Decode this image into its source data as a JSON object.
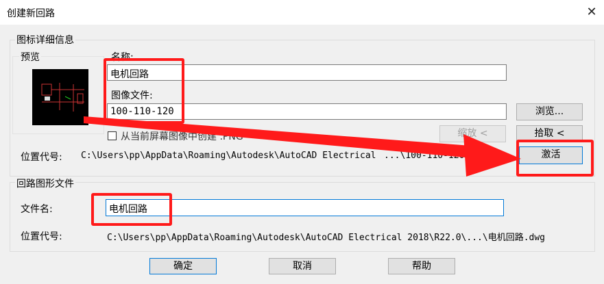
{
  "window": {
    "title": "创建新回路"
  },
  "icon_group": {
    "legend": "图标详细信息",
    "preview_label": "预览",
    "name_label": "名称:",
    "name_value": "电机回路",
    "image_file_label": "图像文件:",
    "image_file_value": "100-110-120",
    "browse_button": "浏览...",
    "create_from_screen_label": "从当前屏幕图像中创建 .PNG",
    "zoom_button": "缩放 <",
    "pick_button": "拾取 <",
    "location_label": "位置代号:",
    "location_value": "C:\\Users\\pp\\AppData\\Roaming\\Autodesk\\AutoCAD Electrical",
    "location_tail": "...\\100-110-120.PNG",
    "activate_button": "激活"
  },
  "circuit_group": {
    "legend": "回路图形文件",
    "filename_label": "文件名:",
    "filename_value": "电机回路",
    "location_label": "位置代号:",
    "location_value": "C:\\Users\\pp\\AppData\\Roaming\\Autodesk\\AutoCAD Electrical 2018\\R22.0\\...\\电机回路.dwg"
  },
  "footer": {
    "ok_button": "确定",
    "cancel_button": "取消",
    "help_button": "帮助"
  },
  "colors": {
    "annotation_red": "#ff1a1a",
    "dialog_bg": "#f0f0f0",
    "focus_blue": "#0078d7"
  }
}
